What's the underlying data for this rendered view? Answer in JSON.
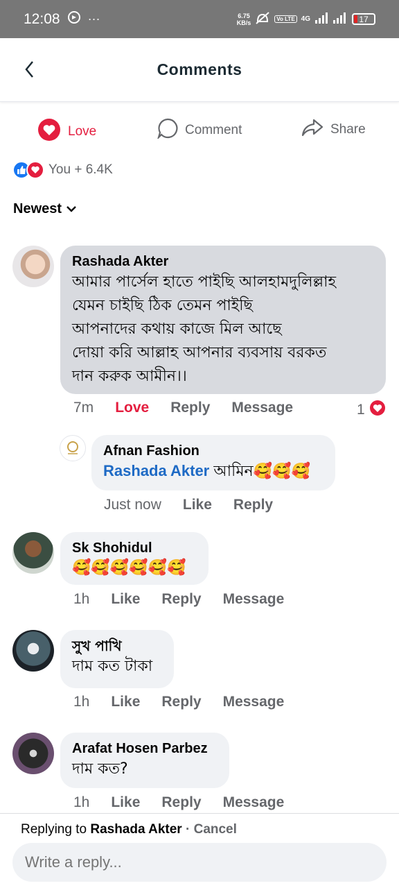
{
  "status": {
    "time": "12:08",
    "speed_value": "6.75",
    "speed_unit": "KB/s",
    "network": "4G",
    "battery": "17"
  },
  "header": {
    "title": "Comments"
  },
  "actions": {
    "love": "Love",
    "comment": "Comment",
    "share": "Share"
  },
  "reactions": {
    "summary": "You + 6.4K"
  },
  "sort": {
    "label": "Newest"
  },
  "comments": [
    {
      "author": "Rashada Akter",
      "lines": [
        "আমার পার্সেল হাতে পাইছি আলহামদুলিল্লাহ",
        "যেমন চাইছি ঠিক তেমন পাইছি",
        "আপনাদের কথায় কাজে মিল আছে",
        "দোয়া করি আল্লাহ আপনার ব্যবসায় বরকত",
        "দান করুক আমীন।।"
      ],
      "time": "7m",
      "love": "Love",
      "reply": "Reply",
      "message": "Message",
      "reaction_count": "1"
    },
    {
      "author": "Afnan Fashion",
      "tag": "Rashada Akter",
      "text": "আমিন",
      "emojis": "🥰🥰🥰",
      "time": "Just now",
      "like": "Like",
      "reply": "Reply"
    },
    {
      "author": "Sk Shohidul",
      "emojis": "🥰🥰🥰🥰🥰🥰",
      "time": "1h",
      "like": "Like",
      "reply": "Reply",
      "message": "Message"
    },
    {
      "author": "সুখ পাখি",
      "text": "দাম কত টাকা",
      "time": "1h",
      "like": "Like",
      "reply": "Reply",
      "message": "Message"
    },
    {
      "author": "Arafat Hosen Parbez",
      "text": "দাম কত?",
      "time": "1h",
      "like": "Like",
      "reply": "Reply",
      "message": "Message"
    }
  ],
  "replybar": {
    "prefix": "Replying to",
    "name": "Rashada Akter",
    "separator": " · ",
    "cancel": "Cancel",
    "placeholder": "Write a reply..."
  },
  "colors": {
    "love": "#e41e3f",
    "like": "#1877f2",
    "tag": "#1e6ac5",
    "status_bar": "#777777"
  }
}
